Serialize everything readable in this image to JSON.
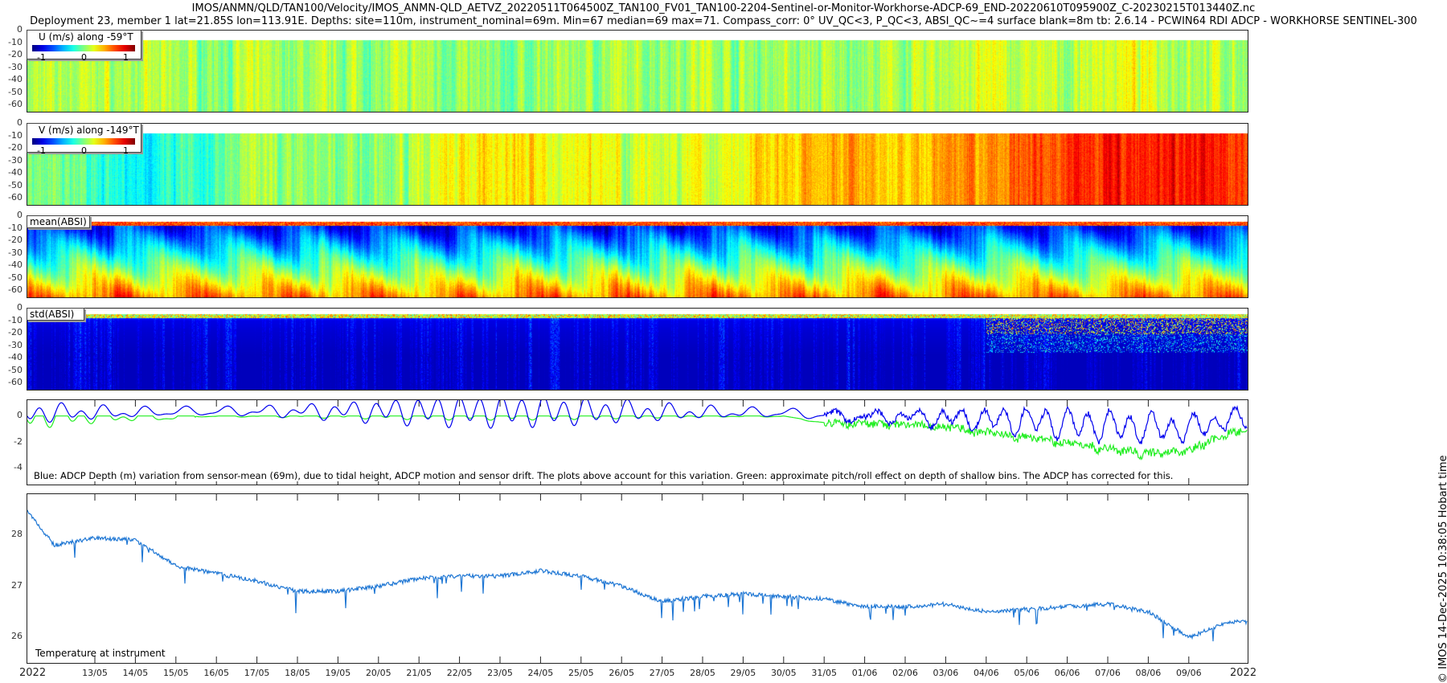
{
  "header": {
    "line1": "IMOS/ANMN/QLD/TAN100/Velocity/IMOS_ANMN-QLD_AETVZ_20220511T064500Z_TAN100_FV01_TAN100-2204-Sentinel-or-Monitor-Workhorse-ADCP-69_END-20220610T095900Z_C-20230215T013440Z.nc",
    "line2": "Deployment 23, member 1 lat=21.85S lon=113.91E. Depths: site=110m, instrument_nominal=69m. Min=67 median=69 max=71. Compass_corr: 0° UV_QC<3, P_QC<3, ABSI_QC~=4 surface blank=8m tb: 2.6.14 - PCWIN64 RDI ADCP - WORKHORSE SENTINEL-300"
  },
  "side_note": "© IMOS 14-Dec-2025 10:38:05 Hobart time",
  "chart_data": [
    {
      "type": "heatmap",
      "title": "U (m/s) along -59°T",
      "clim": [
        -1.2,
        1.2
      ],
      "cb_ticks": [
        "-1",
        "0",
        "1"
      ],
      "yticks": [
        "0",
        "-10",
        "-20",
        "-30",
        "-40",
        "-50",
        "-60"
      ],
      "ylim": [
        -65,
        0
      ],
      "daily_mean": [
        0.1,
        0.1,
        0.15,
        0.1,
        0.1,
        0.05,
        0.1,
        0.05,
        0.1,
        0.05,
        0.1,
        0.05,
        -0.05,
        0.05,
        0.1,
        0.05,
        0.1,
        0.15,
        0.05,
        0.1,
        0.05,
        0.05,
        0.1,
        0.15,
        0.2,
        0.15,
        0.1,
        0.25,
        0.2,
        0.15,
        0.1
      ]
    },
    {
      "type": "heatmap",
      "title": "V (m/s) along -149°T",
      "clim": [
        -1.2,
        1.2
      ],
      "cb_ticks": [
        "-1",
        "0",
        "1"
      ],
      "yticks": [
        "0",
        "-10",
        "-20",
        "-30",
        "-40",
        "-50",
        "-60"
      ],
      "ylim": [
        -65,
        0
      ],
      "daily_mean": [
        0,
        0,
        -0.15,
        -0.35,
        -0.2,
        -0.1,
        0.05,
        0.1,
        0.0,
        0.05,
        0.15,
        0.3,
        0.35,
        0.3,
        0.3,
        0.2,
        0.15,
        0.2,
        0.3,
        0.4,
        0.45,
        0.5,
        0.45,
        0.5,
        0.55,
        0.7,
        0.8,
        0.85,
        0.8,
        0.9,
        0.8
      ]
    },
    {
      "type": "heatmap",
      "title": "mean(ABSI)",
      "clim": [
        0,
        1
      ],
      "yticks": [
        "0",
        "-10",
        "-20",
        "-30",
        "-40",
        "-50",
        "-60"
      ],
      "ylim": [
        -65,
        0
      ],
      "depth_profile": [
        0.2,
        0.15,
        0.25,
        0.35,
        0.45,
        0.55,
        0.65,
        0.75
      ]
    },
    {
      "type": "heatmap",
      "title": "std(ABSI)",
      "clim": [
        0,
        1
      ],
      "yticks": [
        "0",
        "-10",
        "-20",
        "-30",
        "-40",
        "-50",
        "-60"
      ],
      "ylim": [
        -65,
        0
      ],
      "depth_profile": [
        0.35,
        0.1,
        0.08,
        0.07,
        0.06,
        0.06,
        0.06,
        0.06
      ]
    },
    {
      "type": "line",
      "title": "Blue: ADCP Depth (m) variation from sensor-mean (69m), due to tidal height, ADCP motion and sensor drift. The plots above account for this variation. Green: approximate pitch/roll effect on depth of shallow bins. The ADCP has corrected for this.",
      "yticks": [
        "0",
        "-2",
        "-4"
      ],
      "ylim": [
        -5.2,
        1.2
      ],
      "series": [
        {
          "name": "ADCP depth variation",
          "color": "#0000ee"
        },
        {
          "name": "pitch/roll effect",
          "color": "#22ee22"
        }
      ],
      "blue_trend_by_day": [
        0,
        0,
        0,
        0,
        0.1,
        0.1,
        0.1,
        0.1,
        0.1,
        0.1,
        0.1,
        0.1,
        0.1,
        0.1,
        0.1,
        0.1,
        0,
        0,
        0,
        0,
        -0.2,
        -0.3,
        -0.3,
        -0.4,
        -0.5,
        -0.6,
        -0.8,
        -1.0,
        -1.1,
        -1.2,
        -0.5
      ],
      "green_trend_by_day": [
        0,
        0,
        0,
        0,
        0,
        0,
        0,
        0,
        0,
        0,
        0,
        0,
        0,
        0,
        0,
        0,
        0,
        0,
        0,
        0,
        -0.5,
        -0.6,
        -0.6,
        -0.8,
        -1.2,
        -1.6,
        -2.0,
        -2.4,
        -2.8,
        -2.6,
        -1.2
      ]
    },
    {
      "type": "line",
      "title": "Temperature at instrument",
      "yticks": [
        "26",
        "27",
        "28"
      ],
      "ylim": [
        25.5,
        28.8
      ],
      "color": "#1f77d4",
      "daily_temp": [
        28.8,
        27.8,
        27.95,
        27.9,
        27.4,
        27.25,
        27.1,
        26.9,
        26.9,
        27.0,
        27.15,
        27.2,
        27.2,
        27.3,
        27.2,
        27.0,
        26.7,
        26.8,
        26.85,
        26.8,
        26.75,
        26.6,
        26.6,
        26.65,
        26.5,
        26.55,
        26.6,
        26.65,
        26.5,
        26.0,
        26.3
      ]
    },
    {
      "type": "axis",
      "xticks": [
        "13/05",
        "14/05",
        "15/05",
        "16/05",
        "17/05",
        "18/05",
        "19/05",
        "20/05",
        "21/05",
        "22/05",
        "23/05",
        "24/05",
        "25/05",
        "26/05",
        "27/05",
        "28/05",
        "29/05",
        "30/05",
        "31/05",
        "01/06",
        "02/06",
        "03/06",
        "04/06",
        "05/06",
        "06/06",
        "07/06",
        "08/06",
        "09/06"
      ],
      "year_left": "2022",
      "year_right": "2022"
    }
  ]
}
